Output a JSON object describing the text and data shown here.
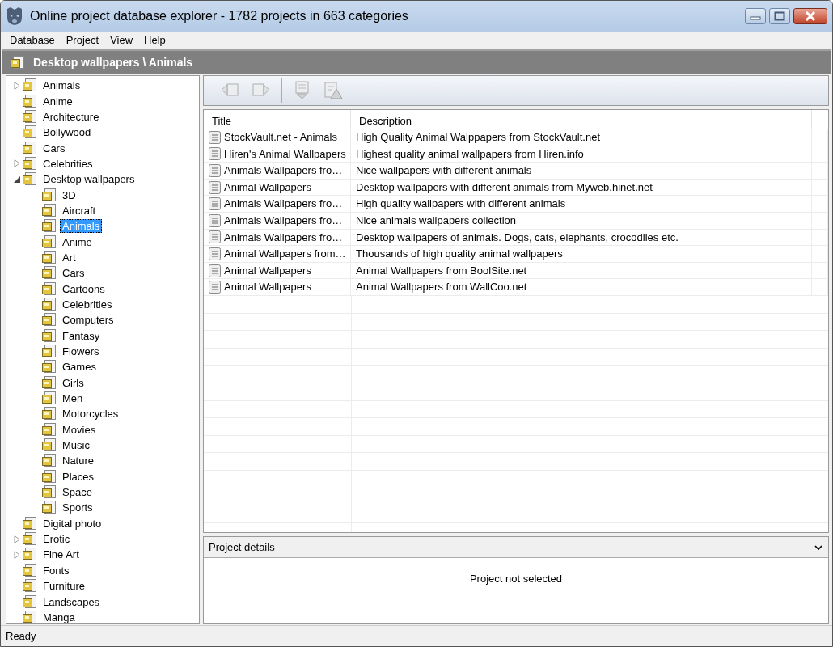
{
  "window": {
    "title": "Online project database explorer - 1782 projects in 663 categories"
  },
  "menu": [
    "Database",
    "Project",
    "View",
    "Help"
  ],
  "breadcrumb": "Desktop wallpapers \\ Animals",
  "tree": [
    {
      "label": "Animals",
      "selected": false,
      "expanded": false
    },
    {
      "label": "Anime",
      "selected": false
    },
    {
      "label": "Architecture",
      "selected": false
    },
    {
      "label": "Bollywood",
      "selected": false
    },
    {
      "label": "Cars",
      "selected": false
    },
    {
      "label": "Celebrities",
      "selected": false,
      "expanded": false
    },
    {
      "label": "Desktop wallpapers",
      "selected": false,
      "expanded": true,
      "children": [
        {
          "label": "3D",
          "selected": false
        },
        {
          "label": "Aircraft",
          "selected": false
        },
        {
          "label": "Animals",
          "selected": true
        },
        {
          "label": "Anime",
          "selected": false
        },
        {
          "label": "Art",
          "selected": false
        },
        {
          "label": "Cars",
          "selected": false
        },
        {
          "label": "Cartoons",
          "selected": false
        },
        {
          "label": "Celebrities",
          "selected": false
        },
        {
          "label": "Computers",
          "selected": false
        },
        {
          "label": "Fantasy",
          "selected": false
        },
        {
          "label": "Flowers",
          "selected": false
        },
        {
          "label": "Games",
          "selected": false
        },
        {
          "label": "Girls",
          "selected": false
        },
        {
          "label": "Men",
          "selected": false
        },
        {
          "label": "Motorcycles",
          "selected": false
        },
        {
          "label": "Movies",
          "selected": false
        },
        {
          "label": "Music",
          "selected": false
        },
        {
          "label": "Nature",
          "selected": false
        },
        {
          "label": "Places",
          "selected": false
        },
        {
          "label": "Space",
          "selected": false
        },
        {
          "label": "Sports",
          "selected": false
        }
      ]
    },
    {
      "label": "Digital photo",
      "selected": false
    },
    {
      "label": "Erotic",
      "selected": false,
      "expanded": false
    },
    {
      "label": "Fine Art",
      "selected": false,
      "expanded": false
    },
    {
      "label": "Fonts",
      "selected": false
    },
    {
      "label": "Furniture",
      "selected": false
    },
    {
      "label": "Landscapes",
      "selected": false
    },
    {
      "label": "Manga",
      "selected": false
    }
  ],
  "toolbar": [
    {
      "kind": "back",
      "disabled": true
    },
    {
      "kind": "forward",
      "disabled": true
    },
    {
      "kind": "separator"
    },
    {
      "kind": "download",
      "disabled": true
    },
    {
      "kind": "report",
      "disabled": true
    }
  ],
  "table": {
    "columns": [
      "Title",
      "Description"
    ],
    "rows": [
      {
        "title": "StockVault.net - Animals",
        "description": "High Quality Animal Walppapers from StockVault.net"
      },
      {
        "title": "Hiren's Animal Wallpapers",
        "description": "Highest quality animal wallpapers from Hiren.info"
      },
      {
        "title": "Animals Wallpapers fro…",
        "description": "Nice wallpapers with different animals"
      },
      {
        "title": "Animal Wallpapers",
        "description": "Desktop wallpapers with different animals from Myweb.hinet.net"
      },
      {
        "title": "Animals Wallpapers fro…",
        "description": "High quality wallpapers with different animals"
      },
      {
        "title": "Animals Wallpapers fro…",
        "description": "Nice animals wallpapers collection"
      },
      {
        "title": "Animals Wallpapers fro…",
        "description": "Desktop wallpapers of animals. Dogs, cats, elephants, crocodiles etc."
      },
      {
        "title": "Animal Wallpapers from…",
        "description": "Thousands of high quality animal wallpapers"
      },
      {
        "title": "Animal Wallpapers",
        "description": "Animal Wallpapers from BoolSite.net"
      },
      {
        "title": "Animal Wallpapers",
        "description": "Animal Wallpapers from WallCoo.net"
      }
    ]
  },
  "details": {
    "title": "Project details",
    "expanded": true,
    "message": "Project not selected"
  },
  "status_bar": "Ready"
}
